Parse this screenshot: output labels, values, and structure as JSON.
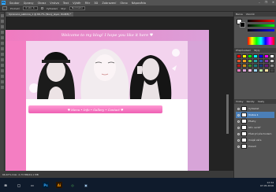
{
  "app": {
    "logo": "Ps",
    "menus": [
      "Soubor",
      "Úpravy",
      "Obraz",
      "Vrstva",
      "Text",
      "Výběr",
      "Filtr",
      "3D",
      "Zobrazení",
      "Okno",
      "Nápověda"
    ],
    "window_controls": [
      "–",
      "❐",
      "✕"
    ]
  },
  "options_bar": {
    "feather_label": "Prolnutí:",
    "feather_value": "0 obr. b.",
    "antialias_label": "Vyhlazení",
    "style_label": "Styl:",
    "style_value": "Normální"
  },
  "document": {
    "tab_title": "Upraveno_sablona_1 @ 66,7% (Nový_layer, RGB/8) *",
    "banner_text": "Welcome to my blog! I hope you like it here ♥",
    "nav_text": "♥ Menu • Info • Gallery • Contact ♥"
  },
  "status": {
    "text": "66,67%   Dok: 2,73 MB/22,1 MB"
  },
  "panels": {
    "color_tabs": [
      "Barva",
      "Vzorník"
    ],
    "style_tabs": [
      "Přizpůsobení",
      "Styly"
    ],
    "layer_tabs": [
      "Vrstvy",
      "Kanály",
      "Cesty"
    ],
    "layers": [
      {
        "name": "Vyhledat",
        "selected": false
      },
      {
        "name": "Vrstva 1",
        "selected": true
      },
      {
        "name": "Efekty",
        "selected": false
      },
      {
        "name": "Stín uvnitř",
        "selected": false
      },
      {
        "name": "Překrytí přechodem",
        "selected": false
      },
      {
        "name": "Vnější záře",
        "selected": false
      },
      {
        "name": "Pozadí",
        "selected": false
      }
    ],
    "swatch_colors": [
      "#ff0000",
      "#ffff00",
      "#00ff00",
      "#00ffff",
      "#0000ff",
      "#ff00ff",
      "#ffffff",
      "#e05a2a",
      "#f4a21c",
      "#78c23a",
      "#2aa6a6",
      "#2a5aa8",
      "#8a3aa8",
      "#cccccc",
      "#b01818",
      "#c88a1a",
      "#3a8a2a",
      "#1a7a7a",
      "#1a3a7a",
      "#6a1a7a",
      "#888888",
      "#f07bc0",
      "#d7a4d8",
      "#ffc0e0",
      "#9fd8ff",
      "#b8e0a0",
      "#ffe0a0",
      "#444444"
    ]
  },
  "colors": {
    "accent_pink": "#f07bc0",
    "accent_lilac": "#d7a4d8",
    "taskbar": "#0f1b2c"
  },
  "taskbar": {
    "items": [
      "⊞",
      "◯",
      "▭",
      "Ps",
      "Ai",
      "◎",
      "▣"
    ],
    "time": "12:34",
    "date": "07.05.2016"
  }
}
